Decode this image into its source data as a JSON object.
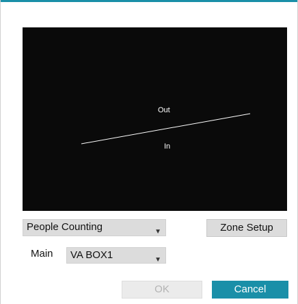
{
  "preview": {
    "out_label": "Out",
    "in_label": "In"
  },
  "mode_select": {
    "value": "People Counting"
  },
  "zone_setup_button": {
    "label": "Zone Setup"
  },
  "stream": {
    "label": "Main",
    "value": "VA BOX1"
  },
  "footer": {
    "ok_label": "OK",
    "cancel_label": "Cancel"
  },
  "colors": {
    "accent": "#1a8fa8",
    "preview_background": "#0a0a0a",
    "counting_line": "#ffffff",
    "disabled_text": "#b3b3b3"
  },
  "icons": {
    "dropdown": "chevron-down-icon"
  }
}
